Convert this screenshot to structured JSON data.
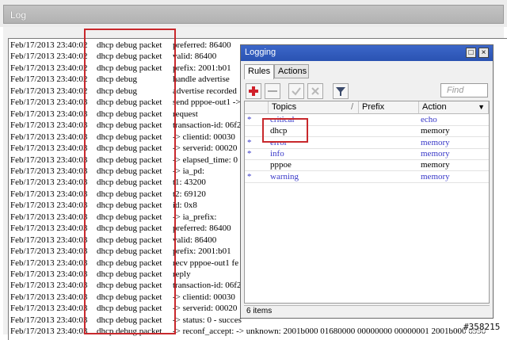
{
  "window": {
    "title": "Log"
  },
  "log_rows": [
    {
      "time": "Feb/17/2013 23:40:02",
      "topic": "dhcp debug packet",
      "message": "preferred: 86400"
    },
    {
      "time": "Feb/17/2013 23:40:02",
      "topic": "dhcp debug packet",
      "message": "valid: 86400"
    },
    {
      "time": "Feb/17/2013 23:40:02",
      "topic": "dhcp debug packet",
      "message": "prefix: 2001:b01"
    },
    {
      "time": "Feb/17/2013 23:40:02",
      "topic": "dhcp debug",
      "message": "handle advertise"
    },
    {
      "time": "Feb/17/2013 23:40:02",
      "topic": "dhcp debug",
      "message": "advertise recorded"
    },
    {
      "time": "Feb/17/2013 23:40:03",
      "topic": "dhcp debug packet",
      "message": "send pppoe-out1 ->"
    },
    {
      "time": "Feb/17/2013 23:40:03",
      "topic": "dhcp debug packet",
      "message": "request"
    },
    {
      "time": "Feb/17/2013 23:40:03",
      "topic": "dhcp debug packet",
      "message": "transaction-id: 06f2"
    },
    {
      "time": "Feb/17/2013 23:40:03",
      "topic": "dhcp debug packet",
      "message": "-> clientid: 00030"
    },
    {
      "time": "Feb/17/2013 23:40:03",
      "topic": "dhcp debug packet",
      "message": "-> serverid: 00020"
    },
    {
      "time": "Feb/17/2013 23:40:03",
      "topic": "dhcp debug packet",
      "message": "-> elapsed_time: 0"
    },
    {
      "time": "Feb/17/2013 23:40:03",
      "topic": "dhcp debug packet",
      "message": "-> ia_pd:"
    },
    {
      "time": "Feb/17/2013 23:40:03",
      "topic": "dhcp debug packet",
      "message": "t1: 43200"
    },
    {
      "time": "Feb/17/2013 23:40:03",
      "topic": "dhcp debug packet",
      "message": "t2: 69120"
    },
    {
      "time": "Feb/17/2013 23:40:03",
      "topic": "dhcp debug packet",
      "message": "id: 0x8"
    },
    {
      "time": "Feb/17/2013 23:40:03",
      "topic": "dhcp debug packet",
      "message": "-> ia_prefix:"
    },
    {
      "time": "Feb/17/2013 23:40:03",
      "topic": "dhcp debug packet",
      "message": "preferred: 86400"
    },
    {
      "time": "Feb/17/2013 23:40:03",
      "topic": "dhcp debug packet",
      "message": "valid: 86400"
    },
    {
      "time": "Feb/17/2013 23:40:03",
      "topic": "dhcp debug packet",
      "message": "prefix: 2001:b01"
    },
    {
      "time": "Feb/17/2013 23:40:03",
      "topic": "dhcp debug packet",
      "message": "recv pppoe-out1 fe"
    },
    {
      "time": "Feb/17/2013 23:40:03",
      "topic": "dhcp debug packet",
      "message": "reply"
    },
    {
      "time": "Feb/17/2013 23:40:03",
      "topic": "dhcp debug packet",
      "message": "transaction-id: 06f2"
    },
    {
      "time": "Feb/17/2013 23:40:03",
      "topic": "dhcp debug packet",
      "message": "-> clientid: 00030"
    },
    {
      "time": "Feb/17/2013 23:40:03",
      "topic": "dhcp debug packet",
      "message": "-> serverid: 00020"
    },
    {
      "time": "Feb/17/2013 23:40:03",
      "topic": "dhcp debug packet",
      "message": "-> status: 0 - succes"
    },
    {
      "time": "Feb/17/2013 23:40:03",
      "topic": "dhcp debug packet",
      "message": "-> reconf_accept: -> unknown: 2001b000 01680000 00000000 00000001 2001b000 6990"
    }
  ],
  "dialog": {
    "title": "Logging",
    "tabs": [
      "Rules",
      "Actions"
    ],
    "find_placeholder": "Find",
    "columns": {
      "topics": "Topics",
      "prefix": "Prefix",
      "action": "Action"
    },
    "rules": [
      {
        "star": "*",
        "topic": "critical",
        "prefix": "",
        "action": "echo",
        "dynamic": true
      },
      {
        "star": "",
        "topic": "dhcp",
        "prefix": "",
        "action": "memory",
        "dynamic": false
      },
      {
        "star": "*",
        "topic": "error",
        "prefix": "",
        "action": "memory",
        "dynamic": true
      },
      {
        "star": "*",
        "topic": "info",
        "prefix": "",
        "action": "memory",
        "dynamic": true
      },
      {
        "star": "",
        "topic": "pppoe",
        "prefix": "",
        "action": "memory",
        "dynamic": false
      },
      {
        "star": "*",
        "topic": "warning",
        "prefix": "",
        "action": "memory",
        "dynamic": true
      }
    ],
    "status": "6 items",
    "window_buttons": [
      "□",
      "×"
    ]
  },
  "watermark": "#358215",
  "colors": {
    "titlebar": "#2a53b2",
    "dynamic_text": "#3838c8",
    "highlight": "#c8282c"
  }
}
